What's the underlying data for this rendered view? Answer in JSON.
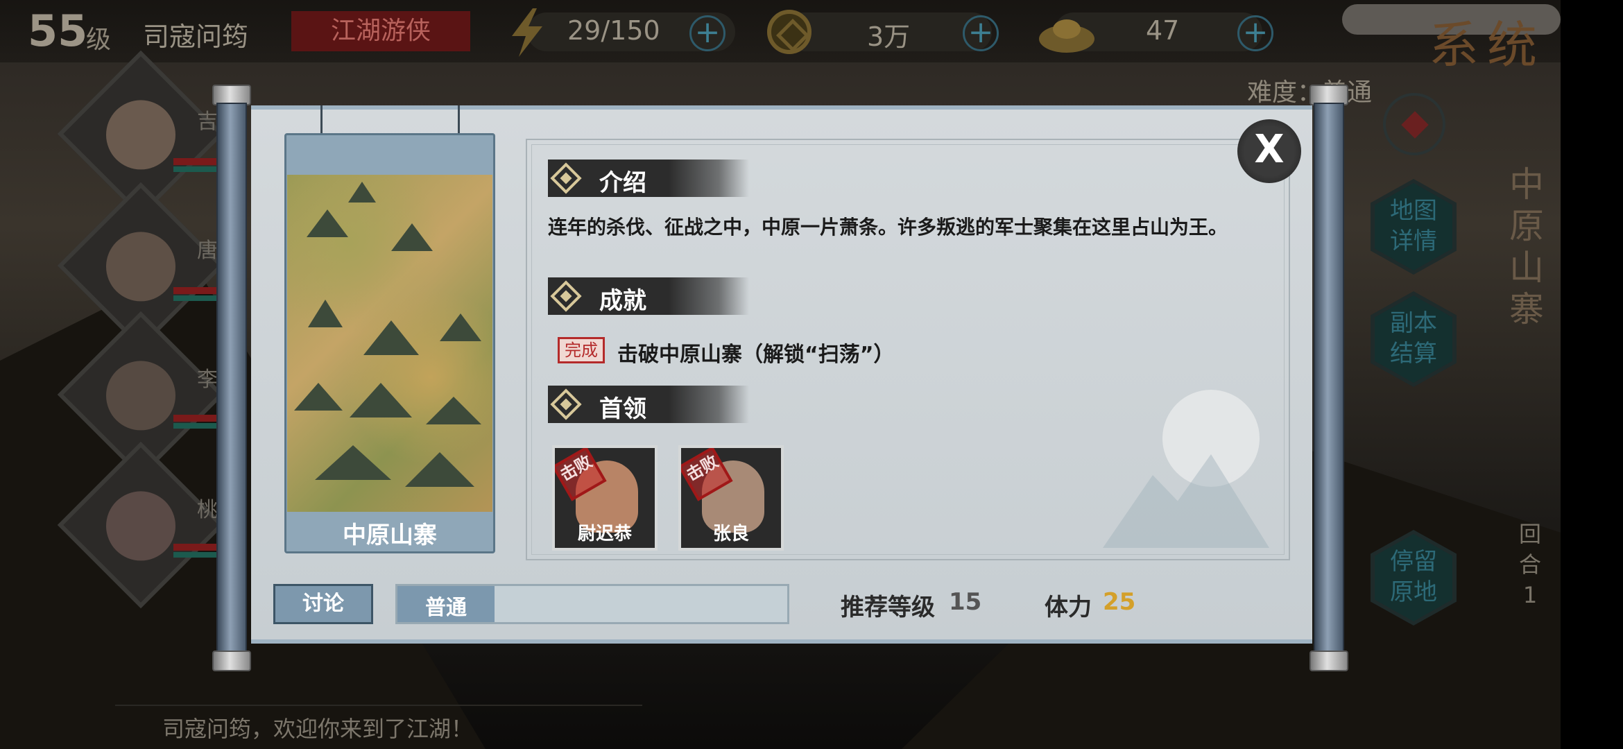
{
  "topbar": {
    "level": "55",
    "level_unit": "级",
    "player_name": "司寇问筠",
    "title": "江湖游侠",
    "stamina": "29/150",
    "coins": "3万",
    "ingots": "47",
    "plus": "+",
    "system": "系统"
  },
  "difficulty_label": "难度：普通",
  "heroes": [
    {
      "name": "吉"
    },
    {
      "name": "唐"
    },
    {
      "name": "李"
    },
    {
      "name": "桃"
    }
  ],
  "side_menu": {
    "map_detail": "地图详情",
    "dungeon_settle": "副本结算",
    "stay": "停留原地",
    "map_title": "中原山寨",
    "round": "回合1"
  },
  "welcome": "司寇问筠，欢迎你来到了江湖！",
  "dialog": {
    "map_name": "中原山寨",
    "close": "X",
    "sections": {
      "intro_title": "介绍",
      "intro_text": "连年的杀伐、征战之中，中原一片萧条。许多叛逃的军士聚集在这里占山为王。",
      "achv_title": "成就",
      "achv_done_tag": "完成",
      "achv_text": "击破中原山寨（解锁“扫荡”）",
      "boss_title": "首领"
    },
    "bosses": [
      {
        "name": "尉迟恭",
        "stamp": "击败"
      },
      {
        "name": "张良",
        "stamp": "击败"
      }
    ],
    "discuss_button": "讨论",
    "difficulty_value": "普通",
    "recommended_level_label": "推荐等级",
    "recommended_level": "15",
    "stamina_label": "体力",
    "stamina_cost": "25"
  },
  "colors": {
    "stamina_cost": "#d4a02a",
    "title_tag_bg": "#5a1414",
    "paper": "#cfd5d8",
    "accent_blue": "#7c98ae"
  }
}
